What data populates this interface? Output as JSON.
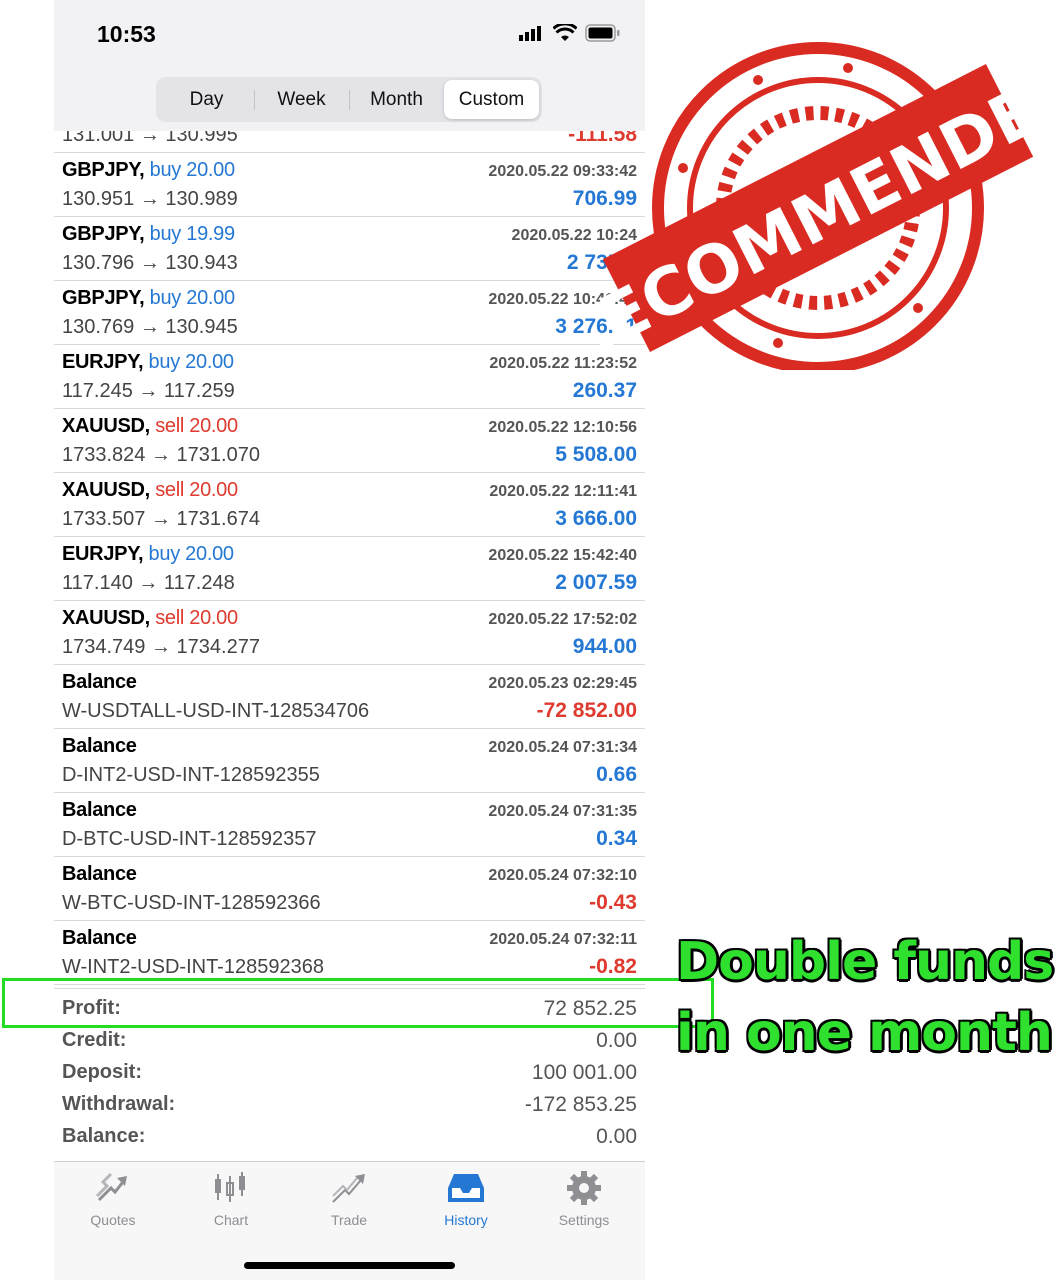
{
  "status": {
    "time": "10:53"
  },
  "segments": [
    {
      "label": "Day"
    },
    {
      "label": "Week"
    },
    {
      "label": "Month"
    },
    {
      "label": "Custom",
      "active": true
    }
  ],
  "partial_row": {
    "prices": "131.001 → 130.995",
    "amount": "-111.58"
  },
  "rows": [
    {
      "symbol": "GBPJPY,",
      "side": "buy",
      "volume": "20.00",
      "time": "2020.05.22 09:33:42",
      "prices": "130.951 → 130.989",
      "amount": "706.99",
      "sign": "pos"
    },
    {
      "symbol": "GBPJPY,",
      "side": "buy",
      "volume": "19.99",
      "time": "2020.05.22 10:24",
      "prices": "130.796 → 130.943",
      "amount": "2 735.3",
      "sign": "pos"
    },
    {
      "symbol": "GBPJPY,",
      "side": "buy",
      "volume": "20.00",
      "time": "2020.05.22 10:41:44",
      "prices": "130.769 → 130.945",
      "amount": "3 276.61",
      "sign": "pos"
    },
    {
      "symbol": "EURJPY,",
      "side": "buy",
      "volume": "20.00",
      "time": "2020.05.22 11:23:52",
      "prices": "117.245 → 117.259",
      "amount": "260.37",
      "sign": "pos"
    },
    {
      "symbol": "XAUUSD,",
      "side": "sell",
      "volume": "20.00",
      "time": "2020.05.22 12:10:56",
      "prices": "1733.824 → 1731.070",
      "amount": "5 508.00",
      "sign": "pos"
    },
    {
      "symbol": "XAUUSD,",
      "side": "sell",
      "volume": "20.00",
      "time": "2020.05.22 12:11:41",
      "prices": "1733.507 → 1731.674",
      "amount": "3 666.00",
      "sign": "pos"
    },
    {
      "symbol": "EURJPY,",
      "side": "buy",
      "volume": "20.00",
      "time": "2020.05.22 15:42:40",
      "prices": "117.140 → 117.248",
      "amount": "2 007.59",
      "sign": "pos"
    },
    {
      "symbol": "XAUUSD,",
      "side": "sell",
      "volume": "20.00",
      "time": "2020.05.22 17:52:02",
      "prices": "1734.749 → 1734.277",
      "amount": "944.00",
      "sign": "pos"
    },
    {
      "symbol": "Balance",
      "side": "",
      "volume": "",
      "time": "2020.05.23 02:29:45",
      "prices": "W-USDTALL-USD-INT-128534706",
      "amount": "-72 852.00",
      "sign": "neg"
    },
    {
      "symbol": "Balance",
      "side": "",
      "volume": "",
      "time": "2020.05.24 07:31:34",
      "prices": "D-INT2-USD-INT-128592355",
      "amount": "0.66",
      "sign": "pos"
    },
    {
      "symbol": "Balance",
      "side": "",
      "volume": "",
      "time": "2020.05.24 07:31:35",
      "prices": "D-BTC-USD-INT-128592357",
      "amount": "0.34",
      "sign": "pos"
    },
    {
      "symbol": "Balance",
      "side": "",
      "volume": "",
      "time": "2020.05.24 07:32:10",
      "prices": "W-BTC-USD-INT-128592366",
      "amount": "-0.43",
      "sign": "neg"
    },
    {
      "symbol": "Balance",
      "side": "",
      "volume": "",
      "time": "2020.05.24 07:32:11",
      "prices": "W-INT2-USD-INT-128592368",
      "amount": "-0.82",
      "sign": "neg"
    }
  ],
  "summary": [
    {
      "label": "Profit:",
      "value": "72 852.25"
    },
    {
      "label": "Credit:",
      "value": "0.00"
    },
    {
      "label": "Deposit:",
      "value": "100 001.00"
    },
    {
      "label": "Withdrawal:",
      "value": "-172 853.25"
    },
    {
      "label": "Balance:",
      "value": "0.00"
    }
  ],
  "tabs": [
    {
      "label": "Quotes",
      "icon": "quotes-icon"
    },
    {
      "label": "Chart",
      "icon": "chart-icon"
    },
    {
      "label": "Trade",
      "icon": "trade-icon"
    },
    {
      "label": "History",
      "icon": "history-icon",
      "active": true
    },
    {
      "label": "Settings",
      "icon": "settings-icon"
    }
  ],
  "overlay": {
    "stamp_text": "RECOMMENDED",
    "caption_line1": "Double funds",
    "caption_line2": "in one month"
  },
  "colors": {
    "buy": "#2478d4",
    "sell": "#de3a2f",
    "stamp": "#d92b22",
    "caption": "#2fe02f"
  }
}
